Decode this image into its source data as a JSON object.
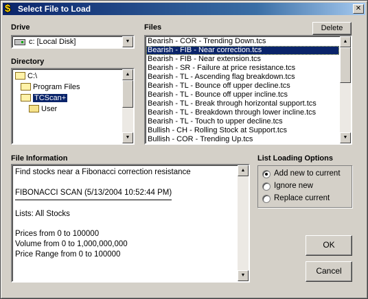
{
  "window": {
    "title": "Select File to Load",
    "close_glyph": "✕",
    "app_icon": "$"
  },
  "drive": {
    "label": "Drive",
    "value": "c: [Local Disk]"
  },
  "directory": {
    "label": "Directory",
    "items": [
      {
        "label": "C:\\",
        "open": true,
        "selected": false
      },
      {
        "label": "Program Files",
        "open": true,
        "selected": false
      },
      {
        "label": "TCScan+",
        "open": true,
        "selected": true
      },
      {
        "label": "User",
        "open": false,
        "selected": false
      }
    ]
  },
  "files": {
    "label": "Files",
    "delete_label": "Delete",
    "items": [
      "Bearish - COR - Trending Down.tcs",
      "Bearish - FIB - Near correction.tcs",
      "Bearish - FIB - Near extension.tcs",
      "Bearish - SR - Failure at price resistance.tcs",
      "Bearish - TL - Ascending flag breakdown.tcs",
      "Bearish - TL - Bounce off upper decline.tcs",
      "Bearish - TL - Bounce off upper incline.tcs",
      "Bearish - TL - Break through horizontal support.tcs",
      "Bearish - TL - Breakdown through lower incline.tcs",
      "Bearish - TL - Touch to upper decline.tcs",
      "Bullish - CH - Rolling Stock at Support.tcs",
      "Bullish - COR - Trending Up.tcs"
    ],
    "selected_index": 1
  },
  "file_info": {
    "label": "File Information",
    "lines": {
      "description": "Find stocks near a Fibonacci correction resistance",
      "scan_header": "FIBONACCI SCAN (5/13/2004 10:52:44 PM)",
      "lists": "Lists: All Stocks",
      "prices": "Prices from 0 to 100000",
      "volume": "Volume from 0 to 1,000,000,000",
      "price_range": "Price Range from 0 to 100000"
    }
  },
  "loading_options": {
    "label": "List Loading Options",
    "options": [
      "Add new to current",
      "Ignore new",
      "Replace current"
    ],
    "selected_index": 0
  },
  "buttons": {
    "ok": "OK",
    "cancel": "Cancel"
  }
}
